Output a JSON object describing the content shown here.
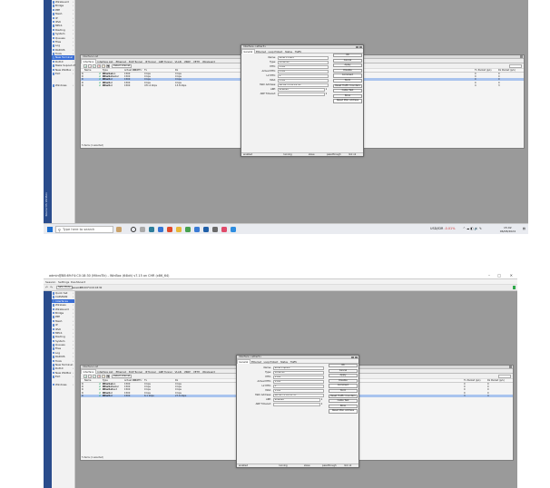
{
  "shot1": {
    "sidebar_text": "RouterOS WinBox",
    "menu": [
      "WireGuard",
      "Bridge",
      "PPP",
      "Mesh",
      "IP",
      "IPv6",
      "MPLS",
      "Routing",
      "System",
      "Queues",
      "Files",
      "Log",
      "RADIUS",
      "Tools",
      "New Terminal",
      "Dot1X",
      "Make Supout.rif",
      "New WinBox",
      "Exit",
      "",
      "",
      "Windows"
    ],
    "menu_selected": 14,
    "ifwin": {
      "title": "Interface List",
      "tabs": [
        "Interface",
        "Interface List",
        "Ethernet",
        "EoIP Tunnel",
        "IP Tunnel",
        "GRE Tunnel",
        "VLAN",
        "VRRP",
        "VETH",
        "WireGuard"
      ],
      "toolbar_detail": "Detect Internet",
      "columns": [
        "Name",
        "Type",
        "Actual MTU",
        "L2 MTU",
        "Tx",
        "Rx",
        "",
        "Tx Packet (p/s)",
        "Rx Packet (p/s)"
      ],
      "rows": [
        [
          "ether1-wan",
          "Ethernet",
          "1500",
          "",
          "0 bps",
          "0 bps",
          "",
          "0",
          "0"
        ],
        [
          "ether2-master",
          "Ethernet",
          "1500",
          "",
          "0 bps",
          "0 bps",
          "",
          "0",
          "0"
        ],
        [
          "ether3",
          "Ethernet",
          "1500",
          "",
          "0 bps",
          "0 bps",
          "",
          "0",
          "0"
        ],
        [
          "ether4",
          "Ethernet",
          "1500",
          "",
          "0 bps",
          "0 bps",
          "",
          "0",
          "0"
        ],
        [
          "ether5",
          "Ethernet",
          "1500",
          "",
          "471.0 kbps",
          "13.8 kbps",
          "",
          "4",
          "3"
        ]
      ],
      "selected_row": 2,
      "footer": "5 items (1 selected)"
    },
    "dialog": {
      "title": "Interface <ether3>",
      "tabs": [
        "General",
        "Ethernet",
        "Loop Protect",
        "Status",
        "Traffic"
      ],
      "fields": [
        {
          "label": "Name:",
          "value": "ether3-client"
        },
        {
          "label": "Type:",
          "value": "Ethernet"
        },
        {
          "label": "MTU:",
          "value": "1500"
        },
        {
          "label": "Actual MTU:",
          "value": "1500"
        },
        {
          "label": "L2 MTU:",
          "value": "0"
        },
        {
          "label": "MAX:",
          "value": "1500"
        },
        {
          "label": "MAC Address:",
          "value": "B8:69:F4:C0:18:3A"
        },
        {
          "label": "ARP:",
          "value": "enabled"
        },
        {
          "label": "ARP Timeout:",
          "value": ""
        }
      ],
      "buttons": [
        "OK",
        "Cancel",
        "Apply",
        "Disable",
        "Comment",
        "Torch",
        "Reset Traffic Counters",
        "Cable Test",
        "Blink",
        "Reset MAC Address"
      ],
      "status": [
        "enabled",
        "running",
        "slave",
        "passthrough",
        "link ok"
      ]
    },
    "taskbar": {
      "search_placeholder": "Type here to search",
      "stock": "USD/IDR",
      "stock_change": "-0.01%",
      "time": "15:02",
      "date": "06/08/2024"
    }
  },
  "shot2": {
    "window_title": "admin@B8:69:F4:C0:18:30 (MikroTik) - WinBox (64bit) v7.15 on CHR (x86_64)",
    "menubar": [
      "Session",
      "Settings",
      "Dashboard"
    ],
    "session_label": "Session:",
    "session_value": "B8:69:F4:C0:18:30",
    "safe_mode": "Safe Mode",
    "menu": [
      "Quick Set",
      "CAPsMAN",
      "Interfaces",
      "Wireless",
      "WireGuard",
      "Bridge",
      "PPP",
      "Mesh",
      "IP",
      "IPv6",
      "MPLS",
      "Routing",
      "System",
      "Queues",
      "Files",
      "Log",
      "RADIUS",
      "Tools",
      "New Terminal",
      "Dot1X",
      "New WinBox",
      "Exit",
      "",
      "Windows"
    ],
    "menu_selected": 2,
    "ifwin": {
      "title": "Interface List",
      "tabs": [
        "Interface",
        "Interface List",
        "Ethernet",
        "EoIP Tunnel",
        "IP Tunnel",
        "GRE Tunnel",
        "VLAN",
        "VRRP",
        "VETH",
        "WireGuard"
      ],
      "toolbar_detail": "Detect Internet",
      "columns": [
        "Name",
        "Type",
        "Actual MTU",
        "L2 MTU",
        "Tx",
        "Rx",
        "Tx Packet (p/s)",
        "Rx Packet (p/s)"
      ],
      "rows": [
        [
          "ether1-wan",
          "Ethernet",
          "1500",
          "",
          "0 bps",
          "0 bps",
          "0",
          "0"
        ],
        [
          "ether2-master",
          "Ethernet",
          "1500",
          "",
          "0 bps",
          "0 bps",
          "0",
          "0"
        ],
        [
          "ether3-client",
          "Ethernet",
          "1500",
          "",
          "0 bps",
          "0 bps",
          "0",
          "0"
        ],
        [
          "ether4",
          "Ethernet",
          "1500",
          "",
          "0 bps",
          "0 bps",
          "0",
          "0"
        ],
        [
          "ether5",
          "Ethernet",
          "1500",
          "",
          "6.1 kbps",
          "27.6 kbps",
          "3",
          "4"
        ]
      ],
      "selected_row": 4,
      "footer": "5 items (1 selected)"
    },
    "dialog": {
      "title": "Interface <ether5>",
      "tabs": [
        "General",
        "Ethernet",
        "Loop Protect",
        "Status",
        "Traffic"
      ],
      "fields": [
        {
          "label": "Name:",
          "value": "ether5-uplink"
        },
        {
          "label": "Type:",
          "value": "Ethernet"
        },
        {
          "label": "MTU:",
          "value": "1500"
        },
        {
          "label": "Actual MTU:",
          "value": "1500"
        },
        {
          "label": "L2 MTU:",
          "value": "0"
        },
        {
          "label": "MAX:",
          "value": "1500"
        },
        {
          "label": "MAC Address:",
          "value": "B8:69:F4:C0:18:3C"
        },
        {
          "label": "ARP:",
          "value": "enabled"
        },
        {
          "label": "ARP Timeout:",
          "value": ""
        }
      ],
      "buttons": [
        "OK",
        "Cancel",
        "Apply",
        "Disable",
        "Comment",
        "Torch",
        "Reset Traffic Counters",
        "Cable Test",
        "Blink",
        "Reset MAC Address"
      ],
      "status": [
        "enabled",
        "running",
        "slave",
        "passthrough",
        "link ok"
      ]
    }
  }
}
